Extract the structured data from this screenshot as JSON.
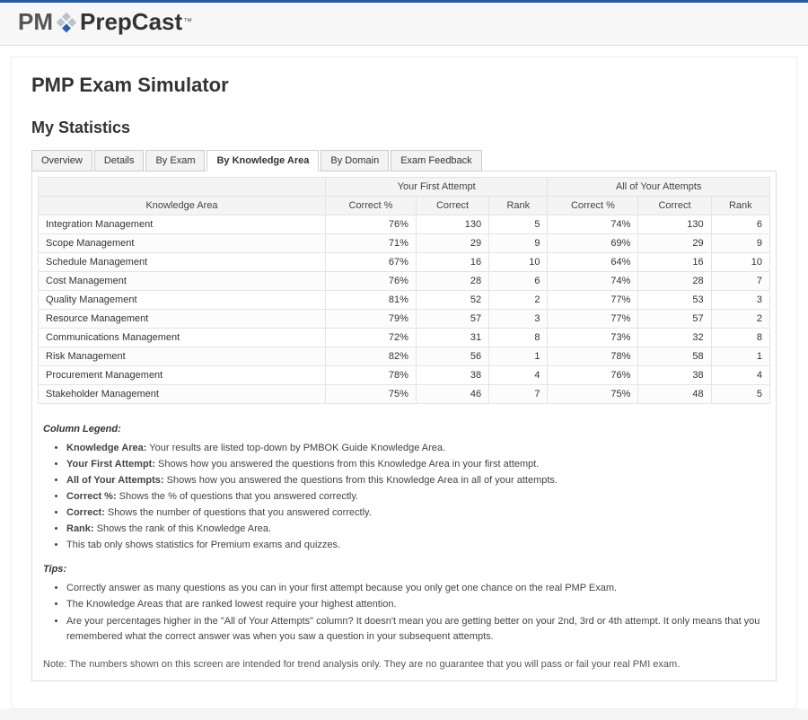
{
  "logo": {
    "pm": "PM",
    "prepcast": "PrepCast",
    "tm": "™"
  },
  "page_title": "PMP Exam Simulator",
  "section_title": "My Statistics",
  "tabs": [
    {
      "label": "Overview",
      "active": false
    },
    {
      "label": "Details",
      "active": false
    },
    {
      "label": "By Exam",
      "active": false
    },
    {
      "label": "By Knowledge Area",
      "active": true
    },
    {
      "label": "By Domain",
      "active": false
    },
    {
      "label": "Exam Feedback",
      "active": false
    }
  ],
  "table": {
    "group_headers": {
      "first": "Your First Attempt",
      "all": "All of Your Attempts"
    },
    "col_headers": {
      "ka": "Knowledge Area",
      "pct": "Correct %",
      "correct": "Correct",
      "rank": "Rank"
    },
    "rows": [
      {
        "ka": "Integration Management",
        "f_pct": "76%",
        "f_correct": "130",
        "f_rank": "5",
        "a_pct": "74%",
        "a_correct": "130",
        "a_rank": "6"
      },
      {
        "ka": "Scope Management",
        "f_pct": "71%",
        "f_correct": "29",
        "f_rank": "9",
        "a_pct": "69%",
        "a_correct": "29",
        "a_rank": "9"
      },
      {
        "ka": "Schedule Management",
        "f_pct": "67%",
        "f_correct": "16",
        "f_rank": "10",
        "a_pct": "64%",
        "a_correct": "16",
        "a_rank": "10"
      },
      {
        "ka": "Cost Management",
        "f_pct": "76%",
        "f_correct": "28",
        "f_rank": "6",
        "a_pct": "74%",
        "a_correct": "28",
        "a_rank": "7"
      },
      {
        "ka": "Quality Management",
        "f_pct": "81%",
        "f_correct": "52",
        "f_rank": "2",
        "a_pct": "77%",
        "a_correct": "53",
        "a_rank": "3"
      },
      {
        "ka": "Resource Management",
        "f_pct": "79%",
        "f_correct": "57",
        "f_rank": "3",
        "a_pct": "77%",
        "a_correct": "57",
        "a_rank": "2"
      },
      {
        "ka": "Communications Management",
        "f_pct": "72%",
        "f_correct": "31",
        "f_rank": "8",
        "a_pct": "73%",
        "a_correct": "32",
        "a_rank": "8"
      },
      {
        "ka": "Risk Management",
        "f_pct": "82%",
        "f_correct": "56",
        "f_rank": "1",
        "a_pct": "78%",
        "a_correct": "58",
        "a_rank": "1"
      },
      {
        "ka": "Procurement Management",
        "f_pct": "78%",
        "f_correct": "38",
        "f_rank": "4",
        "a_pct": "76%",
        "a_correct": "38",
        "a_rank": "4"
      },
      {
        "ka": "Stakeholder Management",
        "f_pct": "75%",
        "f_correct": "46",
        "f_rank": "7",
        "a_pct": "75%",
        "a_correct": "48",
        "a_rank": "5"
      }
    ]
  },
  "legend": {
    "title": "Column Legend:",
    "items": [
      {
        "b": "Knowledge Area:",
        "t": " Your results are listed top-down by PMBOK Guide Knowledge Area."
      },
      {
        "b": "Your First Attempt:",
        "t": " Shows how you answered the questions from this Knowledge Area in your first attempt."
      },
      {
        "b": "All of Your Attempts:",
        "t": " Shows how you answered the questions from this Knowledge Area in all of your attempts."
      },
      {
        "b": "Correct %:",
        "t": " Shows the % of questions that you answered correctly."
      },
      {
        "b": "Correct:",
        "t": " Shows the number of questions that you answered correctly."
      },
      {
        "b": "Rank:",
        "t": " Shows the rank of this Knowledge Area."
      },
      {
        "b": "",
        "t": "This tab only shows statistics for Premium exams and quizzes."
      }
    ]
  },
  "tips": {
    "title": "Tips:",
    "items": [
      "Correctly answer as many questions as you can in your first attempt because you only get one chance on the real PMP Exam.",
      "The Knowledge Areas that are ranked lowest require your highest attention.",
      "Are your percentages higher in the \"All of Your Attempts\" column? It doesn't mean you are getting better on your 2nd, 3rd or 4th attempt. It only means that you remembered what the correct answer was when you saw a question in your subsequent attempts."
    ]
  },
  "note": "Note: The numbers shown on this screen are intended for trend analysis only. They are no guarantee that you will pass or fail your real PMI exam."
}
